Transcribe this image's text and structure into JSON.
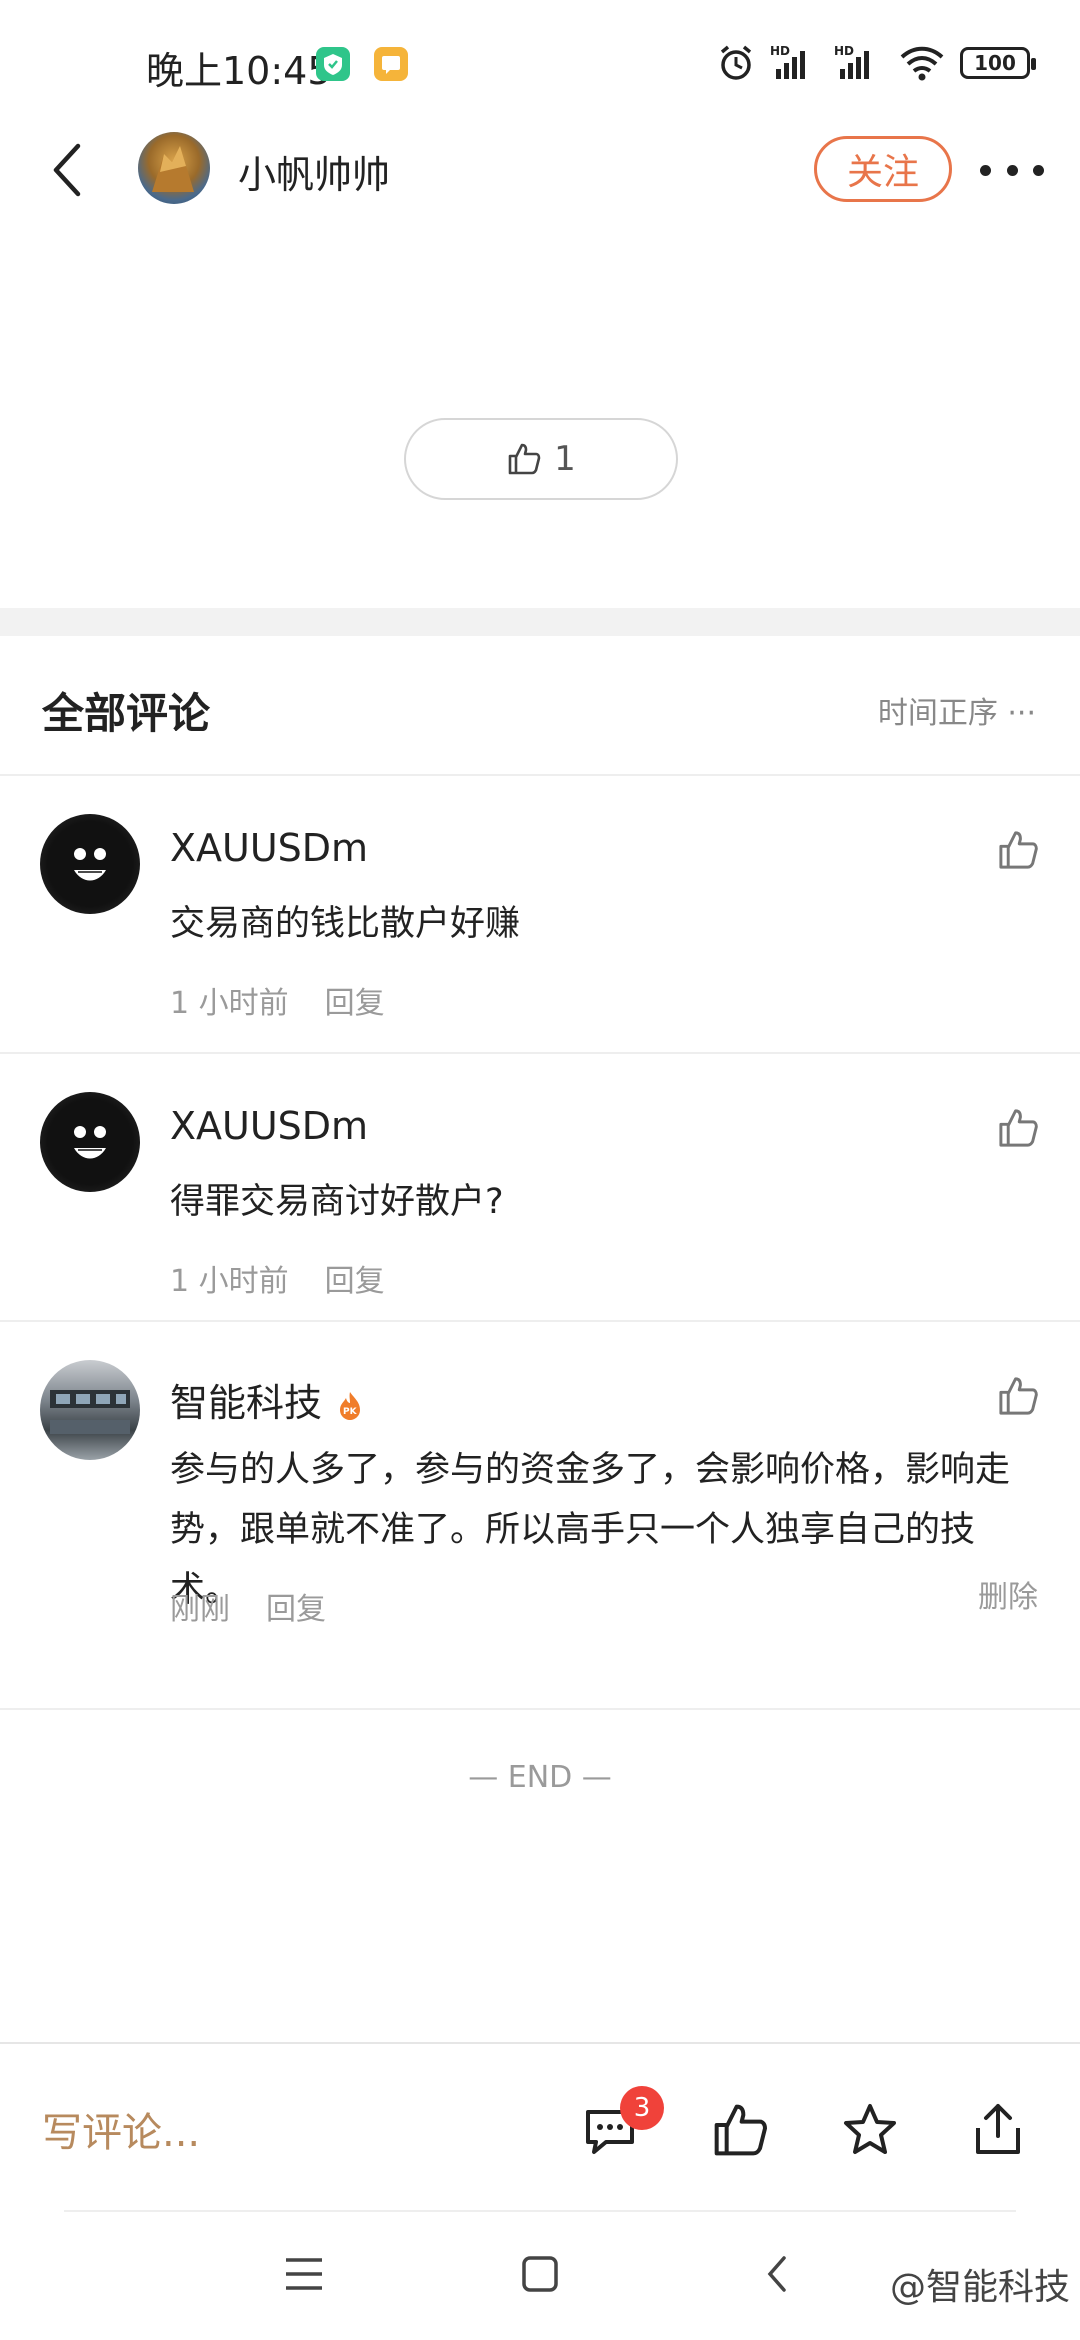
{
  "status_bar": {
    "time": "晚上10:45",
    "battery": "100"
  },
  "header": {
    "author_name": "小帆帅帅",
    "follow_label": "关注"
  },
  "post": {
    "like_count": "1"
  },
  "comments_section": {
    "title": "全部评论",
    "sort_label": "时间正序 ···"
  },
  "comments": [
    {
      "name": "XAUUSDm",
      "text": "交易商的钱比散户好赚",
      "time": "1 小时前",
      "reply_label": "回复"
    },
    {
      "name": "XAUUSDm",
      "text": "得罪交易商讨好散户?",
      "time": "1 小时前",
      "reply_label": "回复"
    },
    {
      "name": "智能科技",
      "text": "参与的人多了，参与的资金多了，会影响价格，影响走势，跟单就不准了。所以高手只一个人独享自己的技术。",
      "time": "刚刚",
      "reply_label": "回复",
      "delete_label": "删除"
    }
  ],
  "end_label": "— END —",
  "bottom_bar": {
    "write_placeholder": "写评论...",
    "comment_count": "3"
  },
  "watermark": "@智能科技",
  "colors": {
    "accent": "#e8754a",
    "write_text": "#b78a5e",
    "badge": "#f0423a"
  }
}
